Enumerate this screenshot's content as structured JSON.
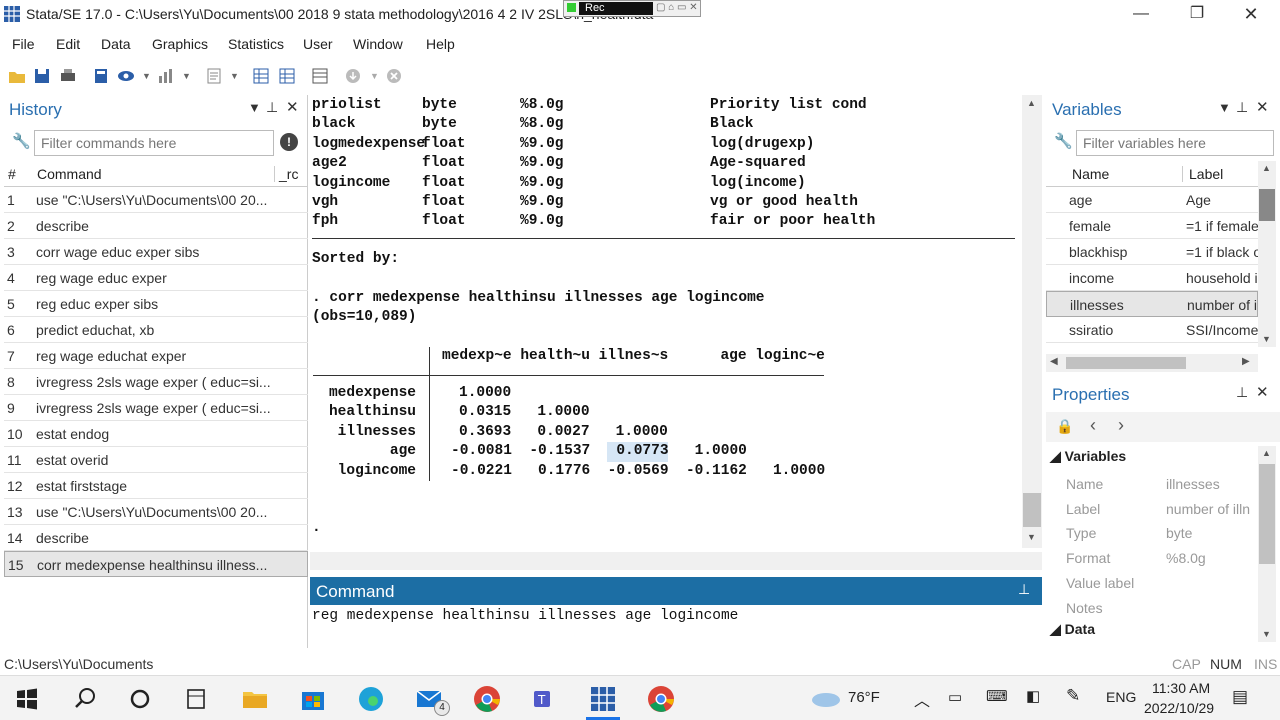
{
  "window": {
    "title": "Stata/SE 17.0 - C:\\Users\\Yu\\Documents\\00 2018 9 stata methodology\\2016 4 2 IV 2SLS\\n_health.dta",
    "rec_label": "Rec"
  },
  "menu": [
    "File",
    "Edit",
    "Data",
    "Graphics",
    "Statistics",
    "User",
    "Window",
    "Help"
  ],
  "history": {
    "title": "History",
    "filter_placeholder": "Filter commands here",
    "col_num": "#",
    "col_cmd": "Command",
    "col_rc": "_rc",
    "rows": [
      {
        "n": "1",
        "cmd": "use \"C:\\Users\\Yu\\Documents\\00 20..."
      },
      {
        "n": "2",
        "cmd": "describe"
      },
      {
        "n": "3",
        "cmd": "corr wage educ exper sibs"
      },
      {
        "n": "4",
        "cmd": "reg wage educ exper"
      },
      {
        "n": "5",
        "cmd": "reg  educ exper sibs"
      },
      {
        "n": "6",
        "cmd": "predict educhat, xb"
      },
      {
        "n": "7",
        "cmd": "reg wage educhat exper"
      },
      {
        "n": "8",
        "cmd": "ivregress 2sls wage  exper ( educ=si..."
      },
      {
        "n": "9",
        "cmd": "ivregress 2sls wage  exper ( educ=si..."
      },
      {
        "n": "10",
        "cmd": "estat endog"
      },
      {
        "n": "11",
        "cmd": "estat overid"
      },
      {
        "n": "12",
        "cmd": "estat firststage"
      },
      {
        "n": "13",
        "cmd": "use \"C:\\Users\\Yu\\Documents\\00 20..."
      },
      {
        "n": "14",
        "cmd": "describe"
      },
      {
        "n": "15",
        "cmd": "corr medexpense healthinsu illness..."
      }
    ]
  },
  "results": {
    "vars": [
      {
        "name": "priolist",
        "type": "byte",
        "fmt": "%8.0g",
        "label": "Priority list cond"
      },
      {
        "name": "black",
        "type": "byte",
        "fmt": "%8.0g",
        "label": "Black"
      },
      {
        "name": "logmedexpense",
        "type": "float",
        "fmt": "%9.0g",
        "label": "log(drugexp)"
      },
      {
        "name": "age2",
        "type": "float",
        "fmt": "%9.0g",
        "label": "Age-squared"
      },
      {
        "name": "logincome",
        "type": "float",
        "fmt": "%9.0g",
        "label": "log(income)"
      },
      {
        "name": "vgh",
        "type": "float",
        "fmt": "%9.0g",
        "label": "vg or good health"
      },
      {
        "name": "fph",
        "type": "float",
        "fmt": "%9.0g",
        "label": "fair or poor health"
      }
    ],
    "sorted_by": "Sorted by:",
    "command": ". corr medexpense healthinsu illnesses age logincome",
    "obs": "(obs=10,089)",
    "corr_header": "medexp~e health~u illnes~s      age loginc~e",
    "corr_rows": [
      {
        "name": "medexpense",
        "vals": "1.0000"
      },
      {
        "name": "healthinsu",
        "vals": "0.0315   1.0000"
      },
      {
        "name": "illnesses",
        "vals": "0.3693   0.0027   1.0000"
      },
      {
        "name": "age",
        "vals": "-0.0081  -0.1537   0.0773   1.0000"
      },
      {
        "name": "logincome",
        "vals": "-0.0221   0.1776  -0.0569  -0.1162   1.0000"
      }
    ],
    "prompt": "."
  },
  "command_panel": {
    "title": "Command",
    "text": "reg medexpense healthinsu illnesses age logincome"
  },
  "variables": {
    "title": "Variables",
    "filter_placeholder": "Filter variables here",
    "col_name": "Name",
    "col_label": "Label",
    "rows": [
      {
        "name": "age",
        "label": "Age"
      },
      {
        "name": "female",
        "label": "=1 if female"
      },
      {
        "name": "blackhisp",
        "label": "=1 if black o"
      },
      {
        "name": "income",
        "label": "household i"
      },
      {
        "name": "illnesses",
        "label": "number of i"
      },
      {
        "name": "ssiratio",
        "label": "SSI/Income"
      }
    ]
  },
  "properties": {
    "title": "Properties",
    "section": "Variables",
    "rows": [
      {
        "k": "Name",
        "v": "illnesses"
      },
      {
        "k": "Label",
        "v": "number of illn"
      },
      {
        "k": "Type",
        "v": "byte"
      },
      {
        "k": "Format",
        "v": "%8.0g"
      },
      {
        "k": "Value label",
        "v": ""
      },
      {
        "k": "Notes",
        "v": ""
      }
    ],
    "section2": "Data"
  },
  "status": {
    "path": "C:\\Users\\Yu\\Documents",
    "cap": "CAP",
    "num": "NUM",
    "ins": "INS"
  },
  "taskbar": {
    "temp": "76°F",
    "lang": "ENG",
    "time": "11:30 AM",
    "date": "2022/10/29",
    "mail_badge": "4"
  }
}
